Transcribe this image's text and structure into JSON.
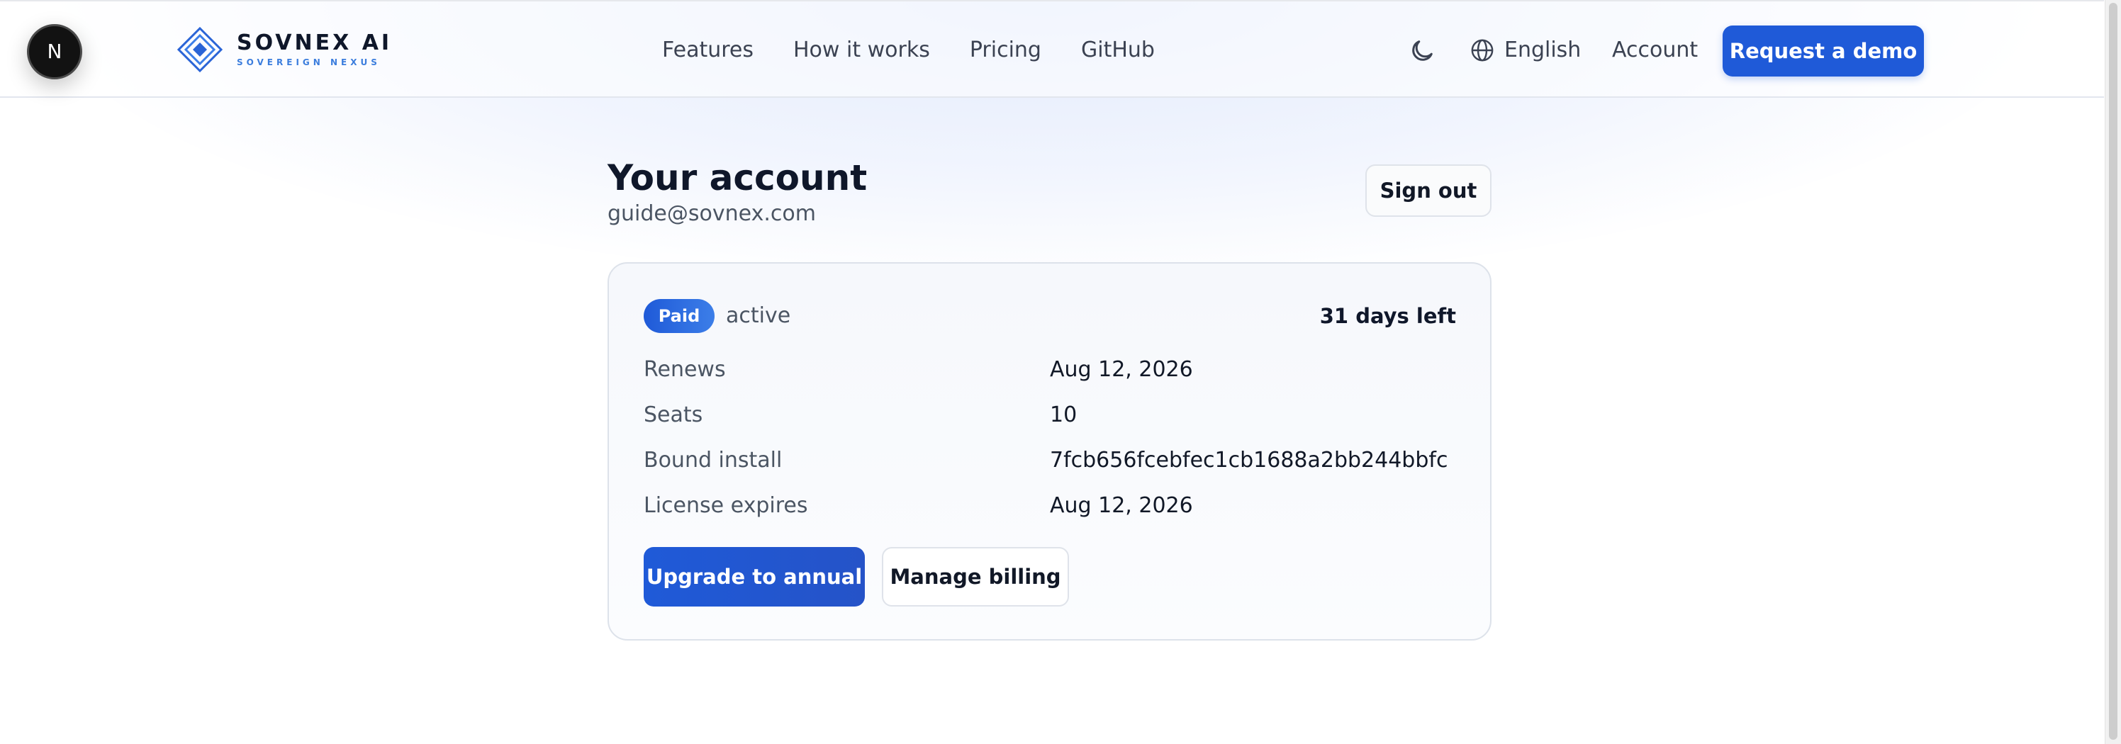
{
  "dev_badge": {
    "letter": "N",
    "icon": "nextjs-icon"
  },
  "brand": {
    "name": "SOVNEX AI",
    "tagline": "SOVEREIGN NEXUS",
    "accent_color": "#1f5ad8",
    "logo_icon": "diamond-logo-icon"
  },
  "nav": {
    "items": [
      {
        "label": "Features"
      },
      {
        "label": "How it works"
      },
      {
        "label": "Pricing"
      },
      {
        "label": "GitHub"
      }
    ]
  },
  "header": {
    "theme_icon": "moon-icon",
    "language_icon": "globe-icon",
    "language": "English",
    "account": "Account",
    "cta": "Request a demo"
  },
  "account": {
    "title": "Your account",
    "email": "guide@sovnex.com",
    "sign_out": "Sign out",
    "plan_badge": "Paid",
    "status": "active",
    "days_left": "31 days left",
    "details": [
      {
        "label": "Renews",
        "value": "Aug 12, 2026"
      },
      {
        "label": "Seats",
        "value": "10"
      },
      {
        "label": "Bound install",
        "value": "7fcb656fcebfec1cb1688a2bb244bbfc"
      },
      {
        "label": "License expires",
        "value": "Aug 12, 2026"
      }
    ],
    "upgrade": "Upgrade to annual",
    "manage_billing": "Manage billing"
  }
}
